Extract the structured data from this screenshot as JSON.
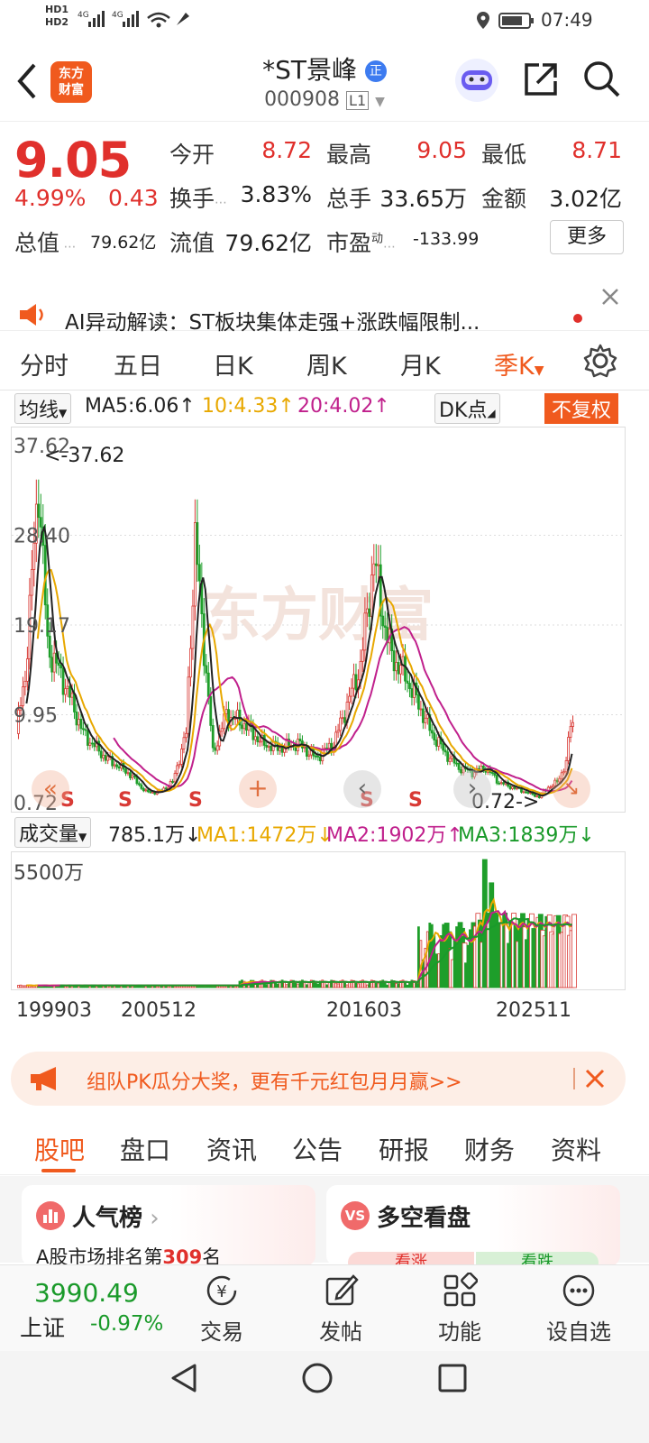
{
  "status": {
    "left_text": "HD1 4G 4G",
    "time": "07:49"
  },
  "header": {
    "logo": "东方\n财富",
    "title": "*ST景峰",
    "badge": "正",
    "code": "000908",
    "level": "L1"
  },
  "quote": {
    "price": "9.05",
    "change_pct": "4.99%",
    "change": "0.43",
    "open_label": "今开",
    "open": "8.72",
    "high_label": "最高",
    "high": "9.05",
    "low_label": "最低",
    "low": "8.71",
    "turnover_label": "换手",
    "turnover": "3.83%",
    "volume_label": "总手",
    "volume": "33.65万",
    "amount_label": "金额",
    "amount": "3.02亿",
    "mktcap_label": "总值",
    "mktcap": "79.62亿",
    "float_label": "流值",
    "float": "79.62亿",
    "pe_label": "市盈",
    "pe_sup": "动",
    "pe": "-133.99",
    "more": "更多"
  },
  "ai_banner": {
    "text": "AI异动解读：ST板块集体走强+涨跌幅限制..."
  },
  "ktabs": [
    "分时",
    "五日",
    "日K",
    "周K",
    "月K",
    "季K"
  ],
  "ma": {
    "select": "均线",
    "ma5": "MA5:6.06↑",
    "ma10": "10:4.33↑",
    "ma20": "20:4.02↑",
    "dk": "DK点",
    "fq": "不复权",
    "color_ma5": "#222222",
    "color_ma10": "#e8a800",
    "color_ma20": "#c0208c"
  },
  "chart": {
    "y_labels": [
      "37.62",
      "28.40",
      "19.17",
      "9.95",
      "0.72"
    ],
    "max_note": "<-37.62",
    "min_note": "0.72->",
    "watermark": "东方财富",
    "signal": "S"
  },
  "vol": {
    "select": "成交量",
    "value": "785.1万↓",
    "ma1": "MA1:1472万↓",
    "ma2": "MA2:1902万↑",
    "ma3": "MA3:1839万↓",
    "y_label": "5500万"
  },
  "dates": [
    "199903",
    "200512",
    "201603",
    "202511"
  ],
  "promo": {
    "text": "组队PK瓜分大奖，更有千元红包月月赢>>"
  },
  "btabs": [
    "股吧",
    "盘口",
    "资讯",
    "公告",
    "研报",
    "财务",
    "资料"
  ],
  "cards": {
    "left_title": "人气榜",
    "left_sub": "A股市场排名第",
    "rank": "309",
    "rank_suffix": "名",
    "right_title": "多空看盘",
    "right_badge": "VS",
    "bull": "看涨",
    "bear": "看跌"
  },
  "nav": {
    "index_value": "3990.49",
    "index_name": "上证",
    "index_change": "-0.97%",
    "trade": "交易",
    "post": "发帖",
    "func": "功能",
    "watch": "设自选"
  }
}
